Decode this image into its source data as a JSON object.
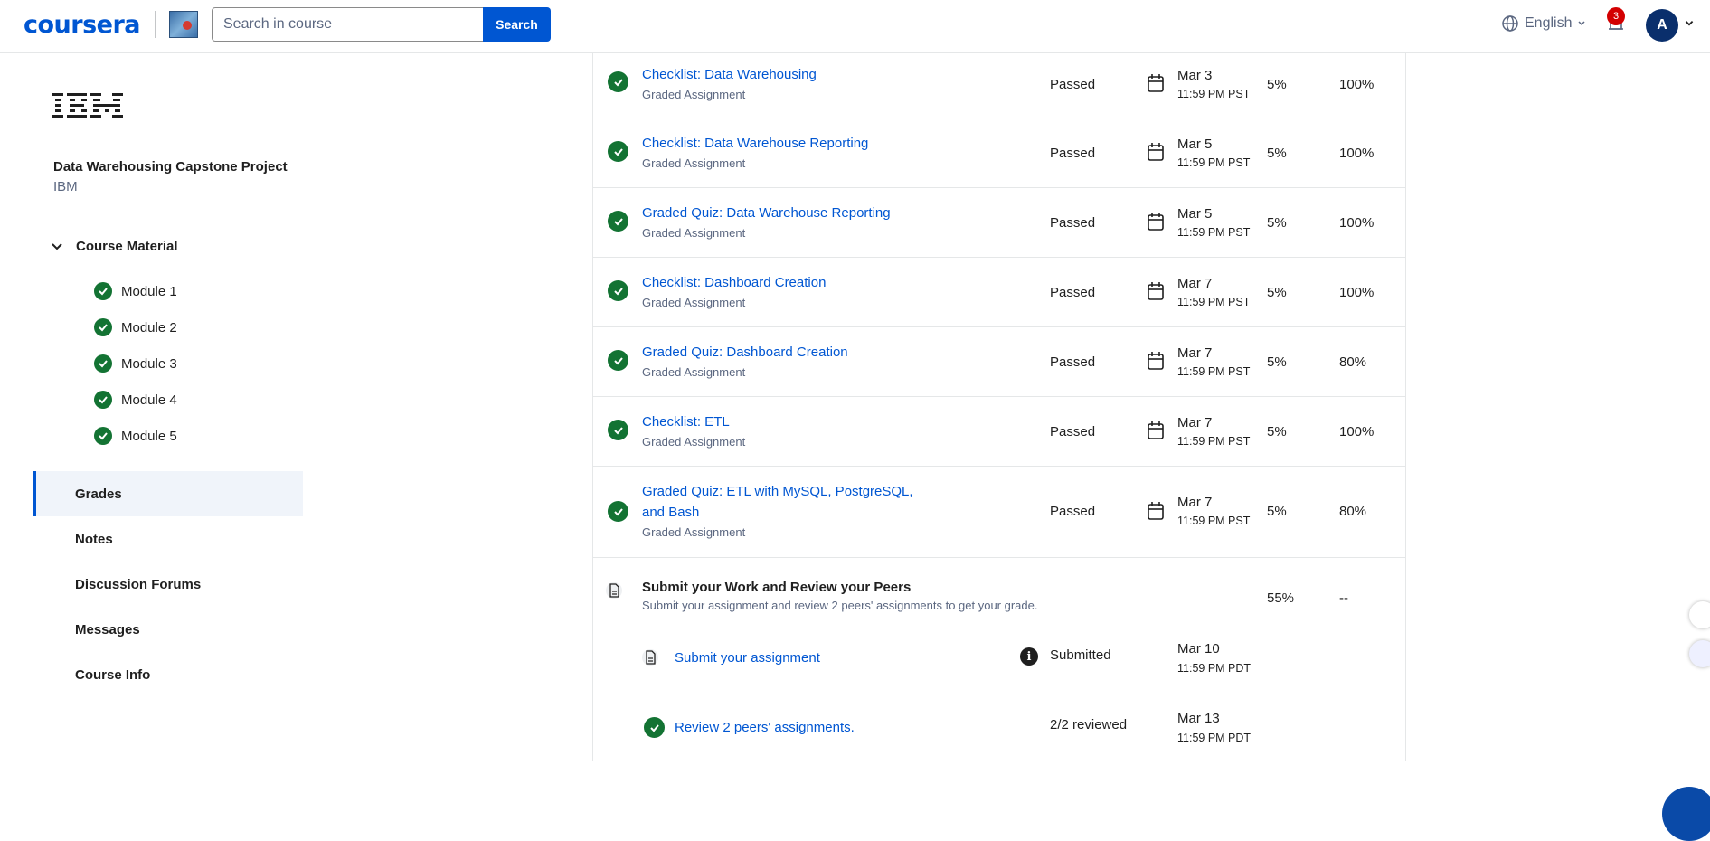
{
  "header": {
    "logo_text": "coursera",
    "search_placeholder": "Search in course",
    "search_button": "Search",
    "language": "English",
    "notification_count": "3",
    "avatar_initial": "A"
  },
  "sidebar": {
    "partner_logo": "IBM",
    "course_title": "Data Warehousing Capstone Project",
    "course_org": "IBM",
    "course_material_label": "Course Material",
    "modules": [
      "Module 1",
      "Module 2",
      "Module 3",
      "Module 4",
      "Module 5"
    ],
    "nav": [
      "Grades",
      "Notes",
      "Discussion Forums",
      "Messages",
      "Course Info"
    ],
    "active_nav": "Grades"
  },
  "grades": {
    "rows": [
      {
        "title": "Checklist: Data Warehousing",
        "type": "Graded Assignment",
        "status": "Passed",
        "date": "Mar 3",
        "time": "11:59 PM PST",
        "weight": "5%",
        "grade": "100%"
      },
      {
        "title": "Checklist: Data Warehouse Reporting",
        "type": "Graded Assignment",
        "status": "Passed",
        "date": "Mar 5",
        "time": "11:59 PM PST",
        "weight": "5%",
        "grade": "100%"
      },
      {
        "title": "Graded Quiz: Data Warehouse Reporting",
        "type": "Graded Assignment",
        "status": "Passed",
        "date": "Mar 5",
        "time": "11:59 PM PST",
        "weight": "5%",
        "grade": "100%"
      },
      {
        "title": "Checklist: Dashboard Creation",
        "type": "Graded Assignment",
        "status": "Passed",
        "date": "Mar 7",
        "time": "11:59 PM PST",
        "weight": "5%",
        "grade": "100%"
      },
      {
        "title": "Graded Quiz: Dashboard Creation",
        "type": "Graded Assignment",
        "status": "Passed",
        "date": "Mar 7",
        "time": "11:59 PM PST",
        "weight": "5%",
        "grade": "80%"
      },
      {
        "title": "Checklist: ETL",
        "type": "Graded Assignment",
        "status": "Passed",
        "date": "Mar 7",
        "time": "11:59 PM PST",
        "weight": "5%",
        "grade": "100%"
      },
      {
        "title_line1": "Graded Quiz: ETL with MySQL, PostgreSQL,",
        "title_line2": "and Bash",
        "type": "Graded Assignment",
        "status": "Passed",
        "date": "Mar 7",
        "time": "11:59 PM PST",
        "weight": "5%",
        "grade": "80%"
      }
    ],
    "peer": {
      "title": "Submit your Work and Review your Peers",
      "subtitle": "Submit your assignment and review 2 peers' assignments to get your grade.",
      "weight": "55%",
      "grade": "--",
      "submit": {
        "label": "Submit your assignment",
        "status": "Submitted",
        "date": "Mar 10",
        "time": "11:59 PM PDT"
      },
      "review": {
        "label": "Review 2 peers' assignments.",
        "status": "2/2 reviewed",
        "date": "Mar 13",
        "time": "11:59 PM PDT"
      }
    }
  },
  "colors": {
    "brand": "#0056d2",
    "success": "#137333",
    "badge": "#d30001"
  }
}
